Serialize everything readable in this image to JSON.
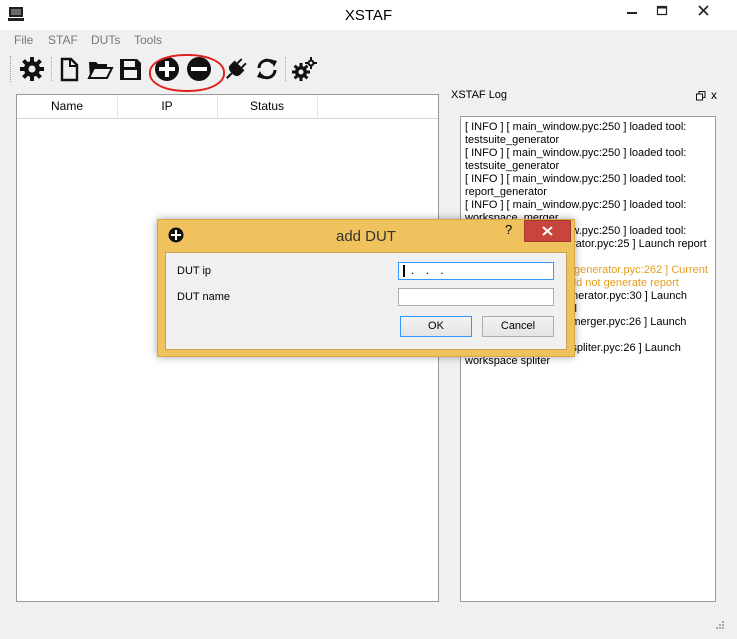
{
  "window": {
    "title": "XSTAF"
  },
  "menu": [
    "File",
    "STAF",
    "DUTs",
    "Tools"
  ],
  "toolbar": {
    "icons": [
      "gear-icon",
      "new-file-icon",
      "open-folder-icon",
      "save-icon",
      "add-circle-icon",
      "remove-circle-icon",
      "plug-icon",
      "refresh-icon",
      "settings-gears-icon"
    ]
  },
  "table": {
    "columns": [
      "Name",
      "IP",
      "Status"
    ]
  },
  "log": {
    "title": "XSTAF Log",
    "float_glyph": "⧉",
    "close_glyph": "x",
    "lines": [
      "[ INFO ] [ main_window.pyc:250 ] loaded tool: testsuite_generator",
      "[ INFO ] [ main_window.pyc:250 ] loaded tool: testsuite_generator",
      "[ INFO ] [ main_window.pyc:250 ] loaded tool: report_generator",
      "[ INFO ] [ main_window.pyc:250 ] loaded tool: workspace_merger",
      "[ INFO ] [ main_window.pyc:250 ] loaded tool:",
      "[ INFO ] [ report_generator.pyc:25 ] Launch report generator",
      "[ WARNING ] [ report_generator.pyc:262 ] Current workspace empty, could not generate report",
      "[ INFO ] [ testsuite_generator.pyc:30 ] Launch testsuite generator tool",
      "[ INFO ] [ workspace_merger.pyc:26 ] Launch workspace merger",
      "[ INFO ] [ workspace_spliter.pyc:26 ] Launch workspace spliter"
    ],
    "warn_index": 6
  },
  "dialog": {
    "title": "add DUT",
    "help_glyph": "?",
    "close_glyph": "✕",
    "ip_label": "DUT ip",
    "ip_value": ". . .",
    "name_label": "DUT name",
    "name_value": "",
    "ok_label": "OK",
    "cancel_label": "Cancel"
  },
  "colors": {
    "dialog_frame": "#f0c25e",
    "dialog_close": "#c7453c",
    "warning_text": "#e59c1f",
    "highlight": "#e0201c"
  }
}
